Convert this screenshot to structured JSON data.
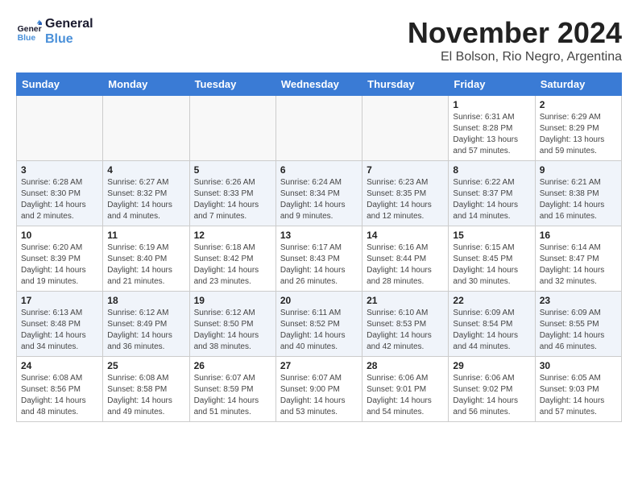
{
  "logo": {
    "line1": "General",
    "line2": "Blue"
  },
  "title": "November 2024",
  "location": "El Bolson, Rio Negro, Argentina",
  "weekdays": [
    "Sunday",
    "Monday",
    "Tuesday",
    "Wednesday",
    "Thursday",
    "Friday",
    "Saturday"
  ],
  "weeks": [
    [
      {
        "day": "",
        "info": ""
      },
      {
        "day": "",
        "info": ""
      },
      {
        "day": "",
        "info": ""
      },
      {
        "day": "",
        "info": ""
      },
      {
        "day": "",
        "info": ""
      },
      {
        "day": "1",
        "info": "Sunrise: 6:31 AM\nSunset: 8:28 PM\nDaylight: 13 hours and 57 minutes."
      },
      {
        "day": "2",
        "info": "Sunrise: 6:29 AM\nSunset: 8:29 PM\nDaylight: 13 hours and 59 minutes."
      }
    ],
    [
      {
        "day": "3",
        "info": "Sunrise: 6:28 AM\nSunset: 8:30 PM\nDaylight: 14 hours and 2 minutes."
      },
      {
        "day": "4",
        "info": "Sunrise: 6:27 AM\nSunset: 8:32 PM\nDaylight: 14 hours and 4 minutes."
      },
      {
        "day": "5",
        "info": "Sunrise: 6:26 AM\nSunset: 8:33 PM\nDaylight: 14 hours and 7 minutes."
      },
      {
        "day": "6",
        "info": "Sunrise: 6:24 AM\nSunset: 8:34 PM\nDaylight: 14 hours and 9 minutes."
      },
      {
        "day": "7",
        "info": "Sunrise: 6:23 AM\nSunset: 8:35 PM\nDaylight: 14 hours and 12 minutes."
      },
      {
        "day": "8",
        "info": "Sunrise: 6:22 AM\nSunset: 8:37 PM\nDaylight: 14 hours and 14 minutes."
      },
      {
        "day": "9",
        "info": "Sunrise: 6:21 AM\nSunset: 8:38 PM\nDaylight: 14 hours and 16 minutes."
      }
    ],
    [
      {
        "day": "10",
        "info": "Sunrise: 6:20 AM\nSunset: 8:39 PM\nDaylight: 14 hours and 19 minutes."
      },
      {
        "day": "11",
        "info": "Sunrise: 6:19 AM\nSunset: 8:40 PM\nDaylight: 14 hours and 21 minutes."
      },
      {
        "day": "12",
        "info": "Sunrise: 6:18 AM\nSunset: 8:42 PM\nDaylight: 14 hours and 23 minutes."
      },
      {
        "day": "13",
        "info": "Sunrise: 6:17 AM\nSunset: 8:43 PM\nDaylight: 14 hours and 26 minutes."
      },
      {
        "day": "14",
        "info": "Sunrise: 6:16 AM\nSunset: 8:44 PM\nDaylight: 14 hours and 28 minutes."
      },
      {
        "day": "15",
        "info": "Sunrise: 6:15 AM\nSunset: 8:45 PM\nDaylight: 14 hours and 30 minutes."
      },
      {
        "day": "16",
        "info": "Sunrise: 6:14 AM\nSunset: 8:47 PM\nDaylight: 14 hours and 32 minutes."
      }
    ],
    [
      {
        "day": "17",
        "info": "Sunrise: 6:13 AM\nSunset: 8:48 PM\nDaylight: 14 hours and 34 minutes."
      },
      {
        "day": "18",
        "info": "Sunrise: 6:12 AM\nSunset: 8:49 PM\nDaylight: 14 hours and 36 minutes."
      },
      {
        "day": "19",
        "info": "Sunrise: 6:12 AM\nSunset: 8:50 PM\nDaylight: 14 hours and 38 minutes."
      },
      {
        "day": "20",
        "info": "Sunrise: 6:11 AM\nSunset: 8:52 PM\nDaylight: 14 hours and 40 minutes."
      },
      {
        "day": "21",
        "info": "Sunrise: 6:10 AM\nSunset: 8:53 PM\nDaylight: 14 hours and 42 minutes."
      },
      {
        "day": "22",
        "info": "Sunrise: 6:09 AM\nSunset: 8:54 PM\nDaylight: 14 hours and 44 minutes."
      },
      {
        "day": "23",
        "info": "Sunrise: 6:09 AM\nSunset: 8:55 PM\nDaylight: 14 hours and 46 minutes."
      }
    ],
    [
      {
        "day": "24",
        "info": "Sunrise: 6:08 AM\nSunset: 8:56 PM\nDaylight: 14 hours and 48 minutes."
      },
      {
        "day": "25",
        "info": "Sunrise: 6:08 AM\nSunset: 8:58 PM\nDaylight: 14 hours and 49 minutes."
      },
      {
        "day": "26",
        "info": "Sunrise: 6:07 AM\nSunset: 8:59 PM\nDaylight: 14 hours and 51 minutes."
      },
      {
        "day": "27",
        "info": "Sunrise: 6:07 AM\nSunset: 9:00 PM\nDaylight: 14 hours and 53 minutes."
      },
      {
        "day": "28",
        "info": "Sunrise: 6:06 AM\nSunset: 9:01 PM\nDaylight: 14 hours and 54 minutes."
      },
      {
        "day": "29",
        "info": "Sunrise: 6:06 AM\nSunset: 9:02 PM\nDaylight: 14 hours and 56 minutes."
      },
      {
        "day": "30",
        "info": "Sunrise: 6:05 AM\nSunset: 9:03 PM\nDaylight: 14 hours and 57 minutes."
      }
    ]
  ]
}
